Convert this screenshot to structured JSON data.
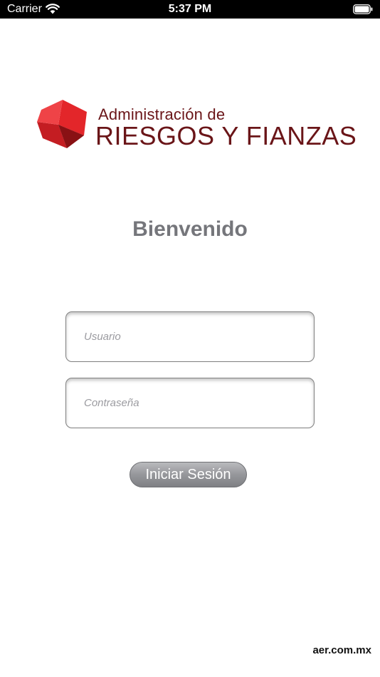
{
  "status_bar": {
    "carrier": "Carrier",
    "time": "5:37 PM",
    "icons": [
      "wifi-icon",
      "battery-icon"
    ]
  },
  "logo": {
    "line1": "Administración de",
    "line2": "RIESGOS Y FIANZAS",
    "icon": "cube-logo-icon"
  },
  "welcome": {
    "title": "Bienvenido"
  },
  "form": {
    "username_placeholder": "Usuario",
    "password_placeholder": "Contraseña",
    "login_label": "Iniciar Sesión"
  },
  "footer": {
    "domain": "aer.com.mx"
  },
  "colors": {
    "brand_dark_red": "#6a1518",
    "brand_red": "#e3262a",
    "heading_gray": "#75767b",
    "button_gray": "#96979b"
  }
}
